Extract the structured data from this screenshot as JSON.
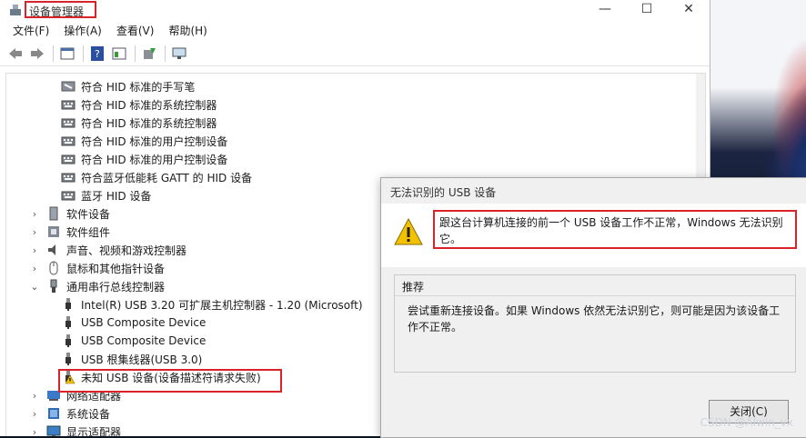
{
  "window": {
    "title": "设备管理器",
    "controls": [
      "—",
      "☐",
      "✕"
    ]
  },
  "menu": [
    "文件(F)",
    "操作(A)",
    "查看(V)",
    "帮助(H)"
  ],
  "tree": {
    "items": [
      {
        "label": "符合 HID 标准的手写笔",
        "level": 2,
        "icon": "pen-device-icon"
      },
      {
        "label": "符合 HID 标准的系统控制器",
        "level": 2,
        "icon": "hid-keyboard-icon"
      },
      {
        "label": "符合 HID 标准的系统控制器",
        "level": 2,
        "icon": "hid-keyboard-icon"
      },
      {
        "label": "符合 HID 标准的用户控制设备",
        "level": 2,
        "icon": "hid-keyboard-icon"
      },
      {
        "label": "符合 HID 标准的用户控制设备",
        "level": 2,
        "icon": "hid-keyboard-icon"
      },
      {
        "label": "符合蓝牙低能耗 GATT 的 HID 设备",
        "level": 2,
        "icon": "hid-keyboard-icon"
      },
      {
        "label": "蓝牙 HID 设备",
        "level": 2,
        "icon": "hid-keyboard-icon"
      },
      {
        "label": "软件设备",
        "level": 1,
        "icon": "software-device-icon",
        "arrow": "›"
      },
      {
        "label": "软件组件",
        "level": 1,
        "icon": "software-component-icon",
        "arrow": "›"
      },
      {
        "label": "声音、视频和游戏控制器",
        "level": 1,
        "icon": "speaker-icon",
        "arrow": "›"
      },
      {
        "label": "鼠标和其他指针设备",
        "level": 1,
        "icon": "mouse-icon",
        "arrow": "›"
      },
      {
        "label": "通用串行总线控制器",
        "level": 1,
        "icon": "usb-icon",
        "arrow": "⌄"
      },
      {
        "label": "Intel(R) USB 3.20 可扩展主机控制器 - 1.20 (Microsoft)",
        "level": 2,
        "icon": "usb-plug-icon"
      },
      {
        "label": "USB Composite Device",
        "level": 2,
        "icon": "usb-plug-icon"
      },
      {
        "label": "USB Composite Device",
        "level": 2,
        "icon": "usb-plug-icon"
      },
      {
        "label": "USB 根集线器(USB 3.0)",
        "level": 2,
        "icon": "usb-plug-icon"
      },
      {
        "label": "未知 USB 设备(设备描述符请求失败)",
        "level": 2,
        "icon": "usb-warning-icon"
      },
      {
        "label": "网络适配器",
        "level": 1,
        "icon": "network-adapter-icon",
        "arrow": "›"
      },
      {
        "label": "系统设备",
        "level": 1,
        "icon": "system-device-icon",
        "arrow": "›"
      },
      {
        "label": "显示适配器",
        "level": 1,
        "icon": "display-adapter-icon",
        "arrow": "›"
      }
    ]
  },
  "dialog": {
    "title": "无法识别的 USB 设备",
    "message": "跟这台计算机连接的前一个 USB 设备工作不正常，Windows 无法识别它。",
    "recommend_title": "推荐",
    "recommend_text": "尝试重新连接设备。如果 Windows 依然无法识别它，则可能是因为该设备工作不正常。",
    "close_label": "关闭(C)"
  },
  "watermark": "CSDN @Alwin_vx",
  "colors": {
    "highlight": "#d8232a",
    "warning": "#f2c200"
  }
}
